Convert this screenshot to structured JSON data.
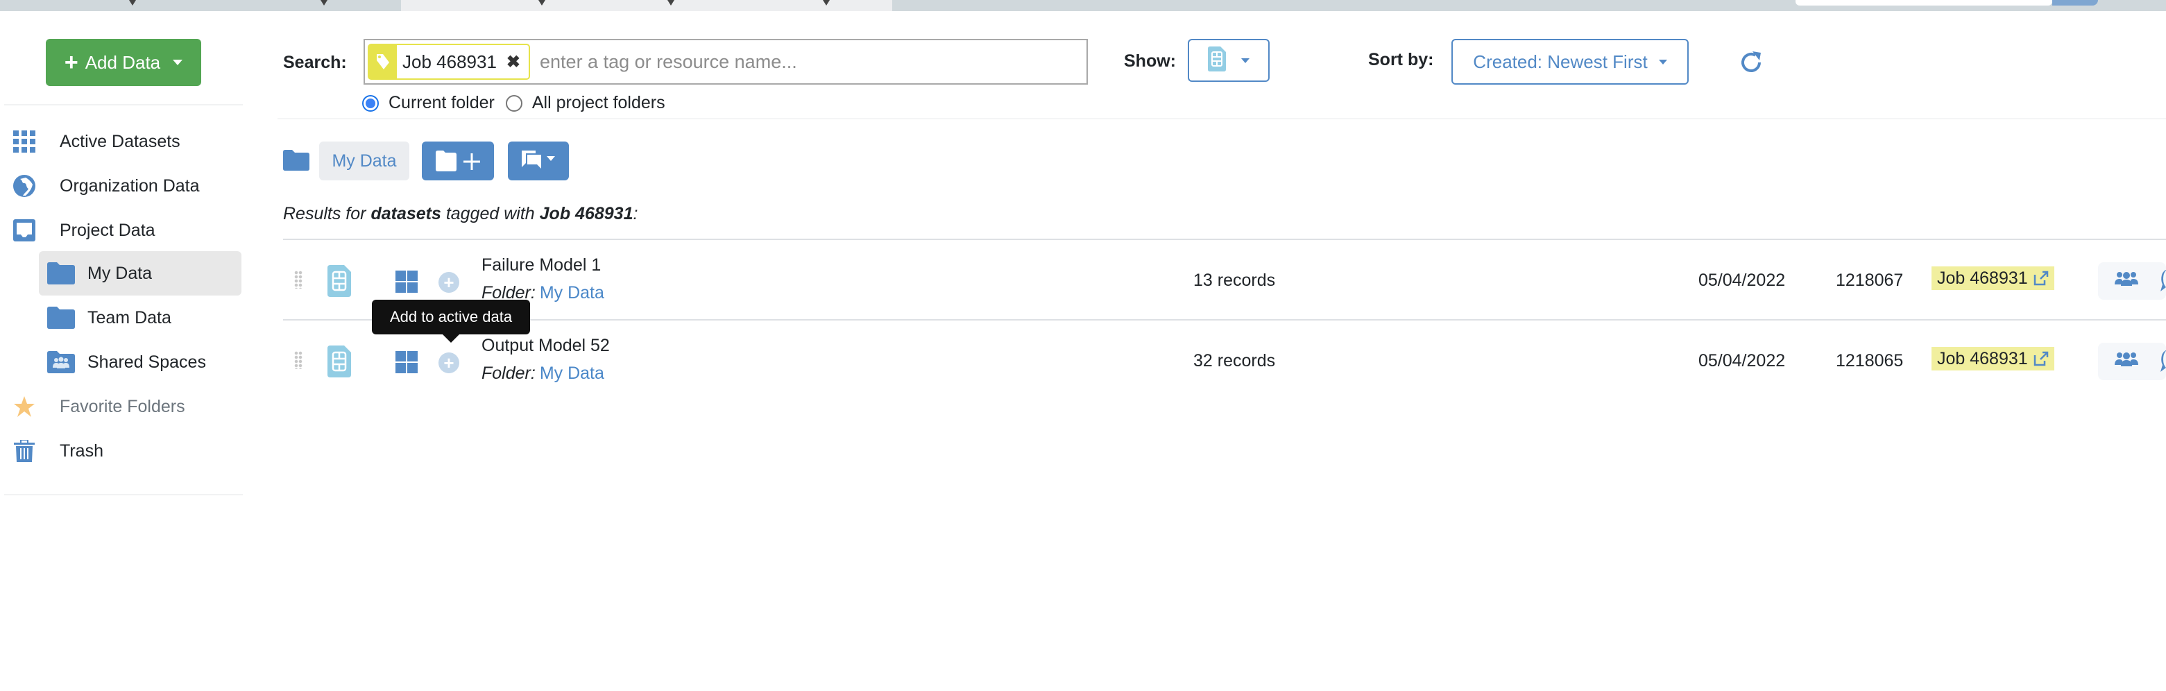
{
  "sidebar": {
    "add_data_label": "Add Data",
    "items": [
      {
        "label": "Active Datasets",
        "icon": "grid-icon"
      },
      {
        "label": "Organization Data",
        "icon": "globe-icon"
      },
      {
        "label": "Project Data",
        "icon": "inbox-icon"
      },
      {
        "label": "My Data",
        "icon": "folder-icon",
        "active": true
      },
      {
        "label": "Team Data",
        "icon": "folder-icon"
      },
      {
        "label": "Shared Spaces",
        "icon": "shared-folder-icon"
      },
      {
        "label": "Favorite Folders",
        "icon": "star-icon"
      },
      {
        "label": "Trash",
        "icon": "trash-icon"
      }
    ]
  },
  "search": {
    "label": "Search:",
    "tag": "Job 468931",
    "placeholder": "enter a tag or resource name...",
    "value": "",
    "scope_options": [
      "Current folder",
      "All project folders"
    ],
    "scope_selected": "Current folder"
  },
  "show": {
    "label": "Show:",
    "icon": "dataset-icon"
  },
  "sort": {
    "label": "Sort by:",
    "selected": "Created: Newest First"
  },
  "breadcrumb": {
    "current": "My Data"
  },
  "results": {
    "prefix": "Results for ",
    "type": "datasets",
    "middle": " tagged with ",
    "tag": "Job 468931",
    "suffix": ":"
  },
  "rows": [
    {
      "name": "Failure Model 1",
      "folder_label": "Folder:",
      "folder": "My Data",
      "records": "13 records",
      "date": "05/04/2022",
      "id": "1218067",
      "tag": "Job 468931"
    },
    {
      "name": "Output Model 52",
      "folder_label": "Folder:",
      "folder": "My Data",
      "records": "32 records",
      "date": "05/04/2022",
      "id": "1218065",
      "tag": "Job 468931"
    }
  ],
  "tooltip": "Add to active data",
  "colors": {
    "primary": "#5289c6",
    "success": "#52a552",
    "tag": "#e6e34c"
  }
}
